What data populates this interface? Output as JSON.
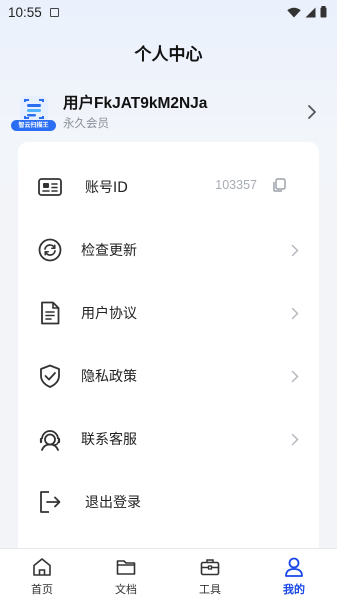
{
  "status_bar": {
    "time": "10:55"
  },
  "header": {
    "title": "个人中心"
  },
  "profile": {
    "username": "用户FkJAT9kM2NJa",
    "membership": "永久会员",
    "avatar_badge": "智云扫描王"
  },
  "menu": {
    "account_id": {
      "label": "账号ID",
      "value": "103357"
    },
    "items": [
      {
        "label": "检查更新"
      },
      {
        "label": "用户协议"
      },
      {
        "label": "隐私政策"
      },
      {
        "label": "联系客服"
      },
      {
        "label": "退出登录"
      }
    ]
  },
  "tabbar": {
    "tabs": [
      {
        "label": "首页"
      },
      {
        "label": "文档"
      },
      {
        "label": "工具"
      },
      {
        "label": "我的"
      }
    ]
  },
  "colors": {
    "accent": "#1a48e8",
    "badge": "#2b6ef2"
  }
}
